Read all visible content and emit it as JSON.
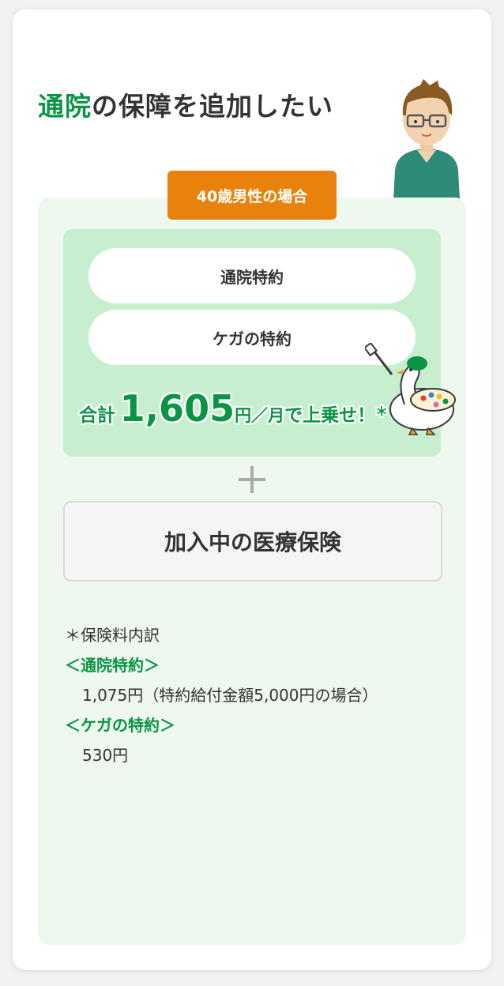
{
  "heading": {
    "accent": "通院",
    "rest": "の保障を追加したい"
  },
  "tag_label": "40歳男性の場合",
  "riders": [
    {
      "label": "通院特約"
    },
    {
      "label": "ケガの特約"
    }
  ],
  "total": {
    "prefix": "合計",
    "amount": "1,605",
    "unit": "円／月",
    "suffix": "で上乗せ！",
    "asterisk": "＊"
  },
  "plus_symbol": "+",
  "current_insurance": "加入中の医療保険",
  "breakdown": {
    "heading": "＊保険料内訳",
    "items": [
      {
        "name": "＜通院特約＞",
        "detail": "1,075円（特約給付金額5,000円の場合）"
      },
      {
        "name": "＜ケガの特約＞",
        "detail": "530円"
      }
    ]
  },
  "colors": {
    "brand_green": "#0a9444",
    "light_green": "#c7efcf",
    "panel_bg": "#eef8ee",
    "tag_orange": "#e8820c"
  },
  "icons": [
    "man-illustration",
    "goose-painter-illustration",
    "plus-icon"
  ]
}
